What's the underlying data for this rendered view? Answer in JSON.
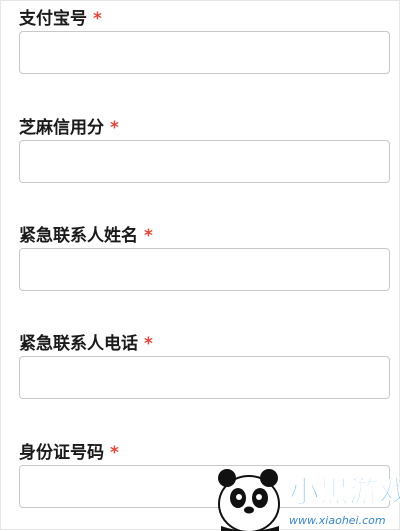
{
  "form": {
    "required_mark": "*",
    "fields": [
      {
        "label": "支付宝号",
        "value": "",
        "placeholder": ""
      },
      {
        "label": "芝麻信用分",
        "value": "",
        "placeholder": ""
      },
      {
        "label": "紧急联系人姓名",
        "value": "",
        "placeholder": ""
      },
      {
        "label": "紧急联系人电话",
        "value": "",
        "placeholder": ""
      },
      {
        "label": "身份证号码",
        "value": "",
        "placeholder": ""
      }
    ]
  },
  "watermark": {
    "brand_text": "小黑游戏",
    "url": "www.xiaohei.com"
  },
  "colors": {
    "required": "#e0463a",
    "input_border": "#c8c8c8",
    "label": "#1a1a1a",
    "watermark_blue": "#1f8fe0"
  }
}
